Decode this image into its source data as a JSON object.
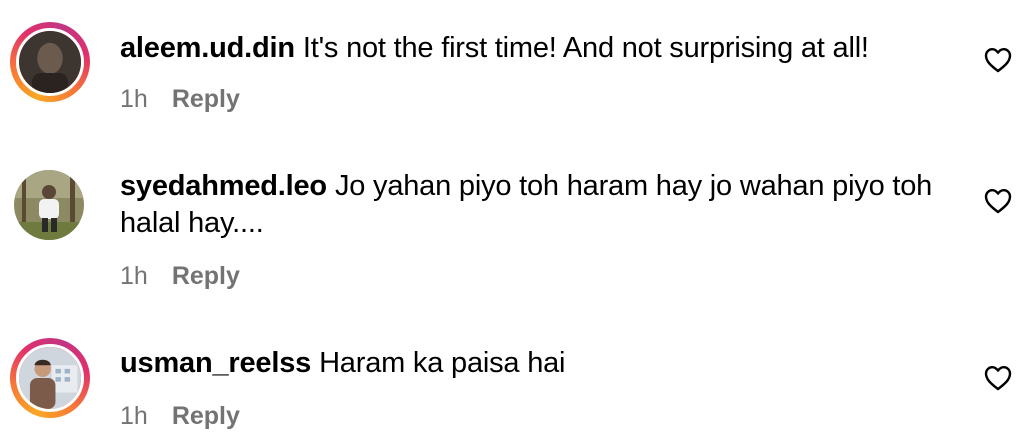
{
  "comments": [
    {
      "username": "aleem.ud.din",
      "text": "It's not the first time! And not surprising at all!",
      "time": "1h",
      "reply_label": "Reply",
      "has_story_ring": true,
      "avatar_icon": "user-avatar",
      "like_icon": "heart-outline-icon"
    },
    {
      "username": "syedahmed.leo",
      "text": "Jo yahan piyo toh haram hay jo wahan piyo toh halal hay....",
      "time": "1h",
      "reply_label": "Reply",
      "has_story_ring": false,
      "avatar_icon": "user-avatar",
      "like_icon": "heart-outline-icon"
    },
    {
      "username": "usman_reelss",
      "text": "Haram ka paisa hai",
      "time": "1h",
      "reply_label": "Reply",
      "has_story_ring": true,
      "avatar_icon": "user-avatar",
      "like_icon": "heart-outline-icon"
    }
  ],
  "colors": {
    "text": "#000000",
    "meta": "#737373",
    "story_ring": [
      "#f9a825",
      "#f77737",
      "#e1306c",
      "#c13584"
    ]
  }
}
